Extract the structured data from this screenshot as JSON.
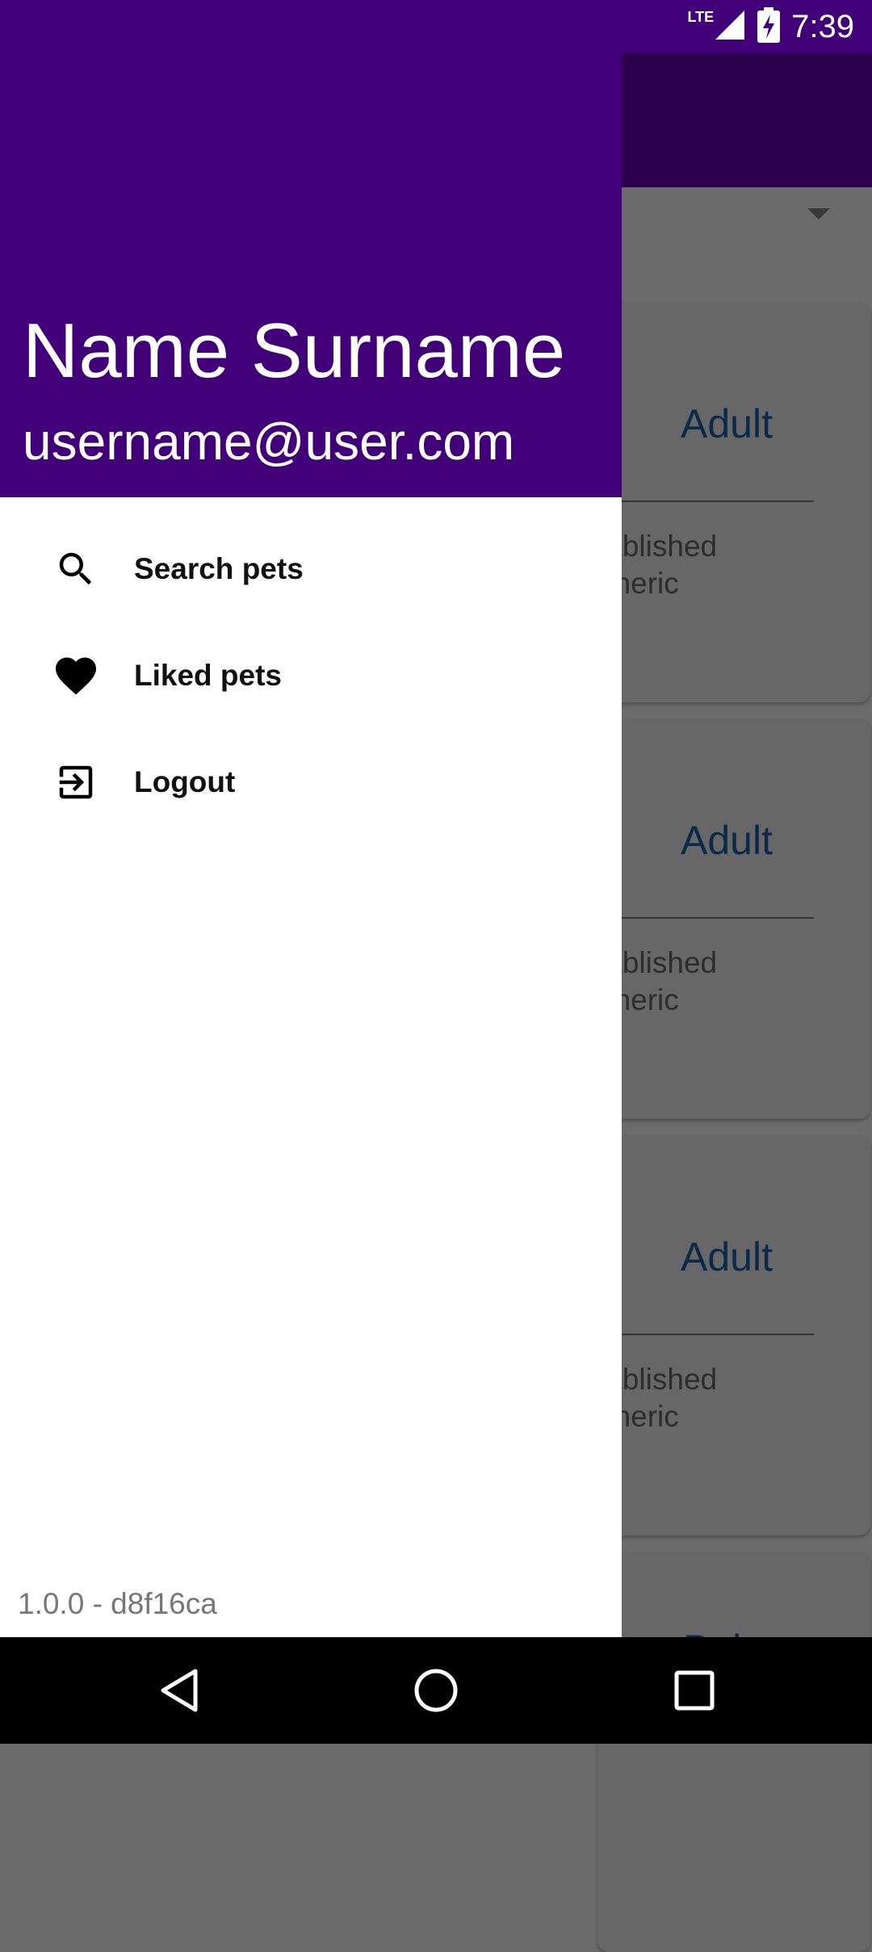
{
  "status_bar": {
    "network": "LTE",
    "time": "7:39"
  },
  "drawer": {
    "name": "Name Surname",
    "email": "username@user.com",
    "menu": [
      {
        "label": "Search pets",
        "icon": "search-icon"
      },
      {
        "label": "Liked pets",
        "icon": "heart-icon"
      },
      {
        "label": "Logout",
        "icon": "logout-icon"
      }
    ],
    "version": "1.0.0 - d8f16ca"
  },
  "background": {
    "cards": [
      {
        "age": "Adult",
        "desc_line1": "tablished",
        "desc_line2": "eneric"
      },
      {
        "age": "Adult",
        "desc_line1": "tablished",
        "desc_line2": "eneric"
      },
      {
        "age": "Adult",
        "desc_line1": "tablished",
        "desc_line2": "eneric"
      },
      {
        "age": "Baby"
      }
    ]
  },
  "colors": {
    "primary": "#410078",
    "primary_dark": "#2d004d",
    "scrim_bg": "#6b6b6b"
  }
}
